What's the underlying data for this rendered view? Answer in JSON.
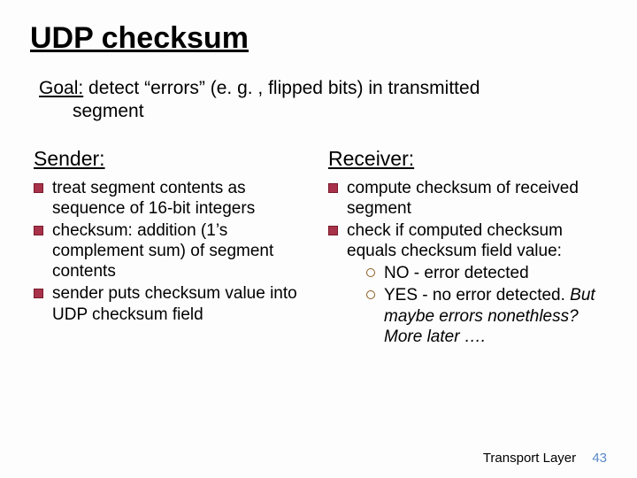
{
  "title": "UDP checksum",
  "goal": {
    "label": "Goal:",
    "line1": " detect “errors” (e. g. , flipped bits) in transmitted",
    "line2": "segment"
  },
  "sender": {
    "heading": "Sender:",
    "items": [
      "treat segment contents as sequence of 16-bit integers",
      "checksum: addition (1’s complement sum) of segment contents",
      "sender puts checksum value into UDP checksum field"
    ]
  },
  "receiver": {
    "heading": "Receiver:",
    "items": [
      "compute checksum of received segment",
      "check if computed checksum equals checksum field value:"
    ],
    "subitems": [
      {
        "prefix": "NO - error detected",
        "italic": ""
      },
      {
        "prefix": "YES - no error detected. ",
        "italic": "But maybe errors nonethless? More later …."
      }
    ]
  },
  "footer": {
    "label": "Transport Layer",
    "page": "43"
  }
}
